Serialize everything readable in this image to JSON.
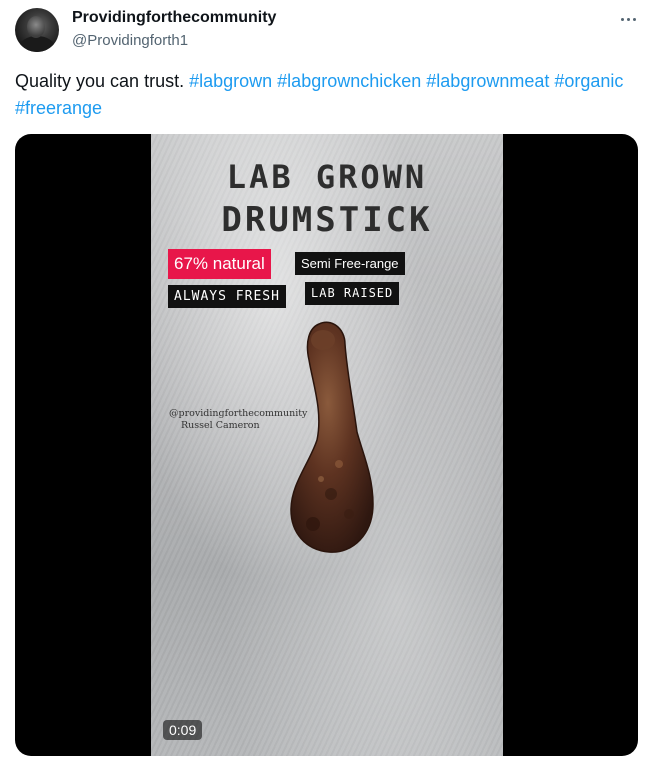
{
  "tweet": {
    "display_name": "Providingforthecommunity",
    "handle": "@Providingforth1",
    "text": "Quality you can trust.",
    "hashtags": [
      "#labgrown",
      "#labgrownchicken",
      "#labgrownmeat",
      "#organic",
      "#freerange"
    ]
  },
  "media": {
    "title_line1": "LAB GROWN",
    "title_line2": "DRUMSTICK",
    "tag_natural": "67% natural",
    "tag_semi": "Semi Free-range",
    "tag_fresh": "ALWAYS FRESH",
    "tag_lab": "LAB RAISED",
    "credit_line1": "@providingforthecommunity",
    "credit_line2": "Russel Cameron",
    "timestamp": "0:09"
  },
  "icons": {
    "more": "more-horizontal-icon"
  },
  "colors": {
    "hashtag": "#1d9bf0",
    "natural_tag": "#e8164a",
    "text": "#0f1419",
    "secondary": "#536471"
  }
}
